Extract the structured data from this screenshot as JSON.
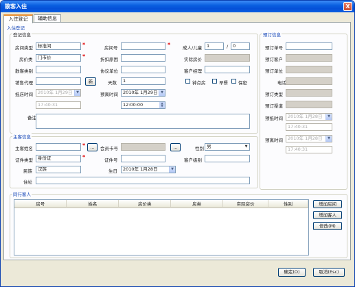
{
  "window": {
    "title": "散客入住",
    "close_label": "X"
  },
  "tabs": [
    {
      "label": "入住登记"
    },
    {
      "label": "辅助信息"
    }
  ],
  "checkin": {
    "section_title": "入住登记",
    "group_title": "登记信息",
    "room_type_label": "房间类型",
    "room_type_value": "标准间",
    "room_no_label": "房间号",
    "room_no_value": "",
    "adults_label": "成人/儿童",
    "adults_value": "1",
    "children_value": "0",
    "slash": "/",
    "price_type_label": "房价类",
    "price_type_value": "门市价",
    "discount_label": "折扣原因",
    "discount_value": "",
    "actual_price_label": "实际房价",
    "actual_price_value": "",
    "guest_type_label": "散客类别",
    "guest_type_value": "",
    "agreement_label": "协议单位",
    "agreement_value": "",
    "manager_label": "客户经理",
    "manager_value": "",
    "sales_label": "销售代理",
    "sales_value": "",
    "new_label": "新",
    "days_label": "天数",
    "days_value": "1",
    "hourly_label": "钟点房",
    "breakfast_label": "早餐",
    "secret_label": "保密",
    "arrival_label": "抵店时间",
    "arrival_date": "2010年 1月29日",
    "arrival_time": "17:40:31",
    "departure_label": "预离时间",
    "departure_date": "2010年 1月29日",
    "departure_time": "12:00:00",
    "remark_label": "备注",
    "remark_value": ""
  },
  "host": {
    "group_title": "主客信息",
    "name_label": "主客姓名",
    "name_value": "",
    "member_label": "会员卡号",
    "member_value": "",
    "gender_label": "性别",
    "gender_value": "男",
    "doc_type_label": "证件类型",
    "doc_type_value": "身份证",
    "doc_no_label": "证件号",
    "doc_no_value": "",
    "level_label": "客户级别",
    "level_value": "",
    "ethnic_label": "民族",
    "ethnic_value": "汉族",
    "birthday_label": "生日",
    "birthday_value": "2010年 1月28日",
    "address_label": "住址",
    "address_value": "",
    "browse_label": "..."
  },
  "reservation": {
    "group_title": "预订信息",
    "no_label": "预订单号",
    "no_value": "",
    "customer_label": "预订客户",
    "customer_value": "",
    "unit_label": "预订单位",
    "unit_value": "",
    "phone_label": "电话",
    "phone_value": "",
    "type_label": "预订类型",
    "type_value": "",
    "channel_label": "预订渠道",
    "channel_value": "",
    "arrival_label": "预抵时间",
    "arrival_date": "2010年 1月28日",
    "arrival_time": "17:40:31",
    "departure_label": "预离时间",
    "departure_date": "2010年 1月28日",
    "departure_time": "17:40:31"
  },
  "companions": {
    "group_title": "同行客人",
    "columns": [
      "房号",
      "姓名",
      "房价类",
      "房类",
      "实际房价",
      "性别"
    ],
    "add_room_label": "增加房间",
    "add_guest_label": "增加客人",
    "edit_label": "修改(M)"
  },
  "footer": {
    "ok_label": "确定(O)",
    "cancel_label": "取消(Esc)"
  }
}
